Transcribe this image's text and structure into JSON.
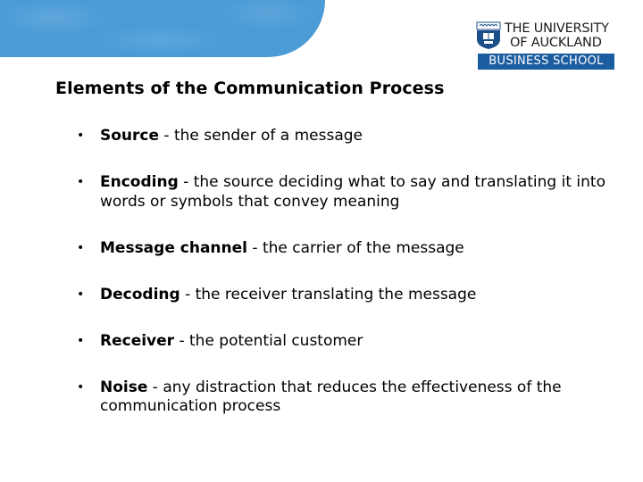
{
  "header": {
    "banner_color": "#4a9bd6",
    "logo": {
      "line1": "THE UNIVERSITY",
      "line2": "OF AUCKLAND",
      "line3": "BUSINESS SCHOOL",
      "crest_icon": "shield-crest-icon",
      "bar_color": "#1b5da0"
    }
  },
  "slide": {
    "title": "Elements of the Communication Process",
    "items": [
      {
        "term": "Source",
        "desc": " - the sender of a message"
      },
      {
        "term": "Encoding",
        "desc": " - the source deciding what to say and translating it into words or symbols that convey meaning"
      },
      {
        "term": "Message channel",
        "desc": " - the carrier of the message"
      },
      {
        "term": "Decoding",
        "desc": " - the receiver translating the message"
      },
      {
        "term": "Receiver",
        "desc": " - the potential customer"
      },
      {
        "term": "Noise",
        "desc": " - any distraction that reduces the effectiveness of the communication process"
      }
    ],
    "bullet_glyph": "•"
  }
}
